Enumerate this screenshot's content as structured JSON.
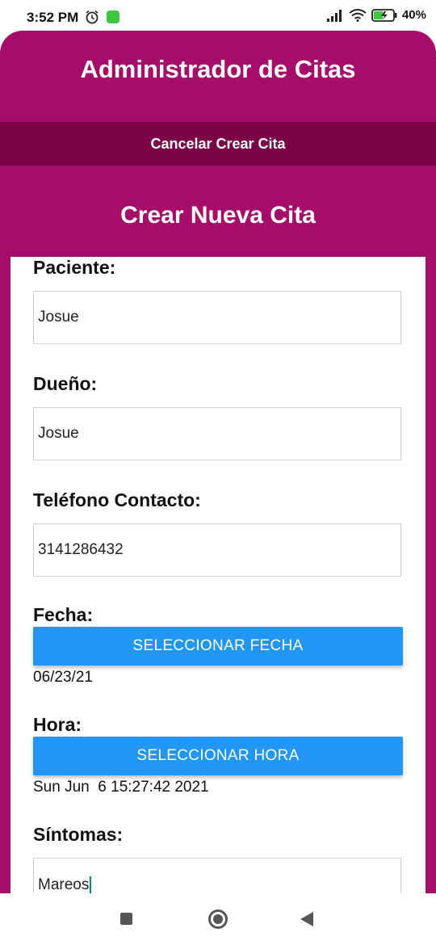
{
  "status_bar": {
    "time": "3:52 PM",
    "battery": "40%"
  },
  "header": {
    "title": "Administrador de Citas",
    "cancel_label": "Cancelar Crear Cita"
  },
  "form": {
    "title": "Crear Nueva Cita",
    "patient_label": "Paciente:",
    "patient_value": "Josue",
    "owner_label": "Dueño:",
    "owner_value": "Josue",
    "phone_label": "Teléfono Contacto:",
    "phone_value": "3141286432",
    "date_label": "Fecha:",
    "date_button": "SELECCIONAR FECHA",
    "date_value": "06/23/21",
    "time_label": "Hora:",
    "time_button": "SELECCIONAR HORA",
    "time_value": "Sun Jun  6 15:27:42 2021",
    "symptoms_label": "Síntomas:",
    "symptoms_value": "Mareos"
  },
  "colors": {
    "primary": "#a50d6a",
    "dark": "#7a0048",
    "button": "#2196f3"
  },
  "icons": [
    "alarm-icon",
    "app-notification-icon",
    "signal-icon",
    "wifi-icon",
    "battery-icon",
    "recents-icon",
    "home-icon",
    "back-icon"
  ]
}
